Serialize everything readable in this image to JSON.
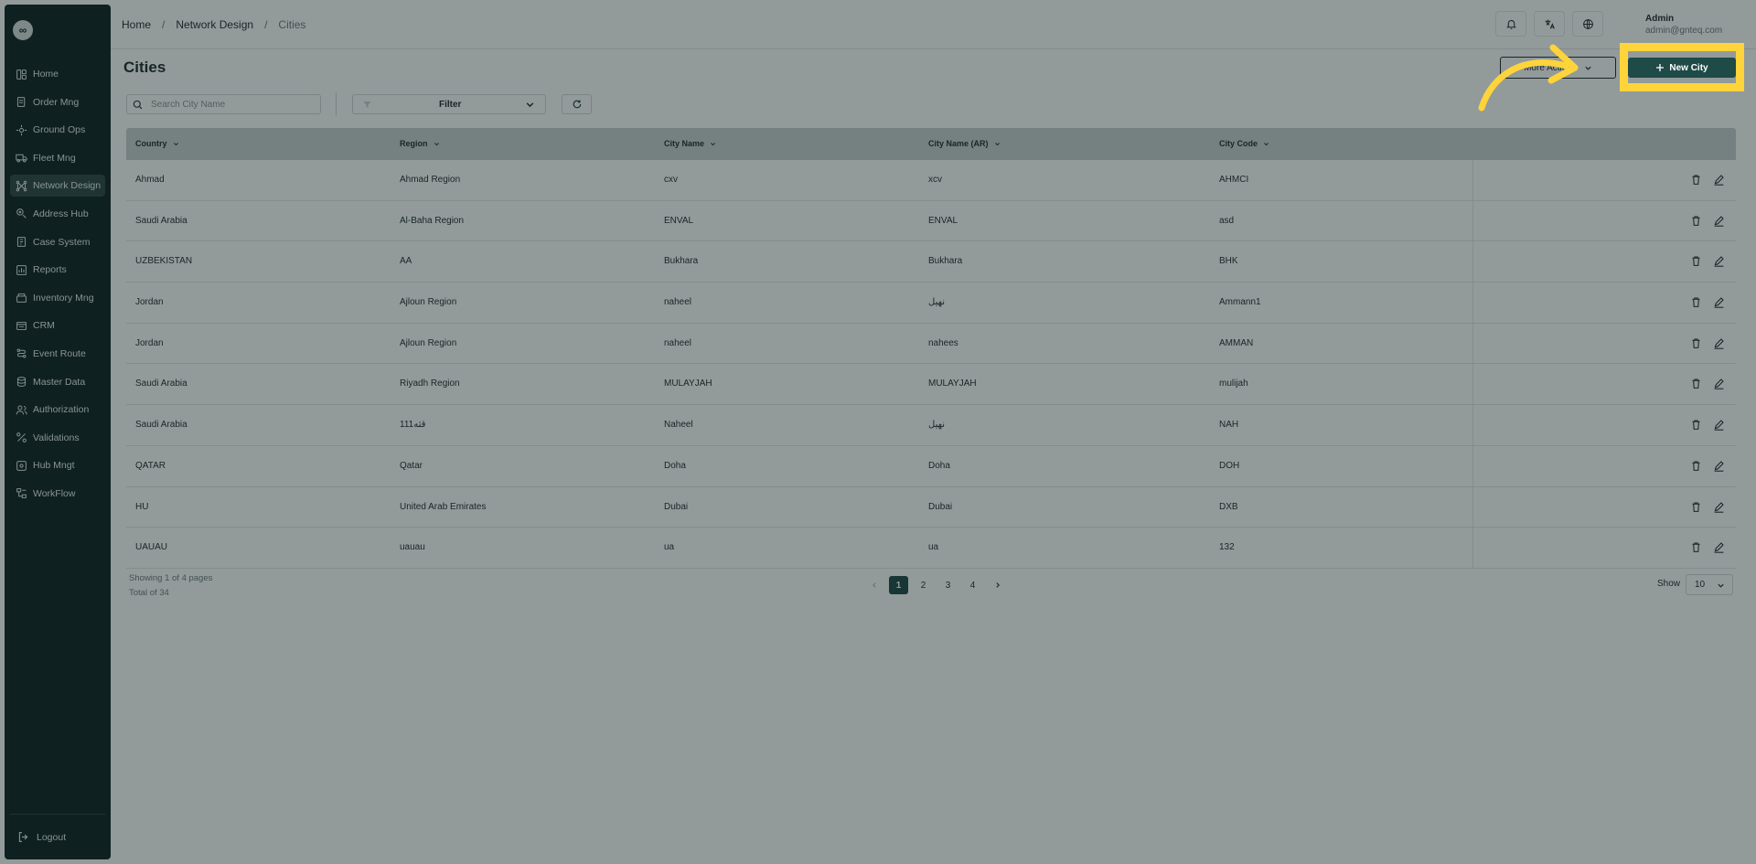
{
  "logo": "∞",
  "sidebar": {
    "items": [
      {
        "label": "Home",
        "icon": "home-icon"
      },
      {
        "label": "Order Mng",
        "icon": "order-icon"
      },
      {
        "label": "Ground Ops",
        "icon": "ground-ops-icon"
      },
      {
        "label": "Fleet Mng",
        "icon": "truck-icon"
      },
      {
        "label": "Network Design",
        "icon": "network-icon"
      },
      {
        "label": "Address Hub",
        "icon": "address-icon"
      },
      {
        "label": "Case System",
        "icon": "case-icon"
      },
      {
        "label": "Reports",
        "icon": "report-icon"
      },
      {
        "label": "Inventory Mng",
        "icon": "inventory-icon"
      },
      {
        "label": "CRM",
        "icon": "crm-icon"
      },
      {
        "label": "Event Route",
        "icon": "route-icon"
      },
      {
        "label": "Master Data",
        "icon": "database-icon"
      },
      {
        "label": "Authorization",
        "icon": "users-icon"
      },
      {
        "label": "Validations",
        "icon": "validation-icon"
      },
      {
        "label": "Hub Mngt",
        "icon": "hub-icon"
      },
      {
        "label": "WorkFlow",
        "icon": "workflow-icon"
      }
    ],
    "active_index": 4,
    "logout_label": "Logout"
  },
  "breadcrumb": {
    "items": [
      "Home",
      "Network Design",
      "Cities"
    ],
    "separator": "/"
  },
  "user": {
    "name": "Admin",
    "email": "admin@gnteq.com"
  },
  "page": {
    "title": "Cities",
    "more_actions_label": "More Actions",
    "new_city_label": "New City"
  },
  "search": {
    "placeholder": "Search City Name"
  },
  "filter": {
    "label": "Filter"
  },
  "table": {
    "columns": [
      "Country",
      "Region",
      "City Name",
      "City Name (AR)",
      "City Code"
    ],
    "rows": [
      [
        "Ahmad",
        "Ahmad Region",
        "cxv",
        "xcv",
        "AHMCI"
      ],
      [
        "Saudi Arabia",
        "Al-Baha Region",
        "ENVAL",
        "ENVAL",
        "asd"
      ],
      [
        "UZBEKISTAN",
        "AA",
        "Bukhara",
        "Bukhara",
        "BHK"
      ],
      [
        "Jordan",
        "Ajloun Region",
        "naheel",
        "نهيل",
        "Ammann1"
      ],
      [
        "Jordan",
        "Ajloun Region",
        "naheel",
        "nahees",
        "AMMAN"
      ],
      [
        "Saudi Arabia",
        "Riyadh Region",
        "MULAYJAH",
        "MULAYJAH",
        "mulijah"
      ],
      [
        "Saudi Arabia",
        "قثه111",
        "Naheel",
        "نهيل",
        "NAH"
      ],
      [
        "QATAR",
        "Qatar",
        "Doha",
        "Doha",
        "DOH"
      ],
      [
        "HU",
        "United Arab Emirates",
        "Dubai",
        "Dubai",
        "DXB"
      ],
      [
        "UAUAU",
        "uauau",
        "ua",
        "ua",
        "132"
      ]
    ]
  },
  "footer": {
    "showing": "Showing 1 of 4 pages",
    "total": "Total of 34",
    "pages": [
      "1",
      "2",
      "3",
      "4"
    ],
    "active_page": "1",
    "show_label": "Show",
    "page_size": "10"
  },
  "colors": {
    "sidebar_bg": "#0f2222",
    "accent": "#1e4a48",
    "highlight": "#ffd43a",
    "overlay": "rgba(15,30,30,0.45)"
  }
}
